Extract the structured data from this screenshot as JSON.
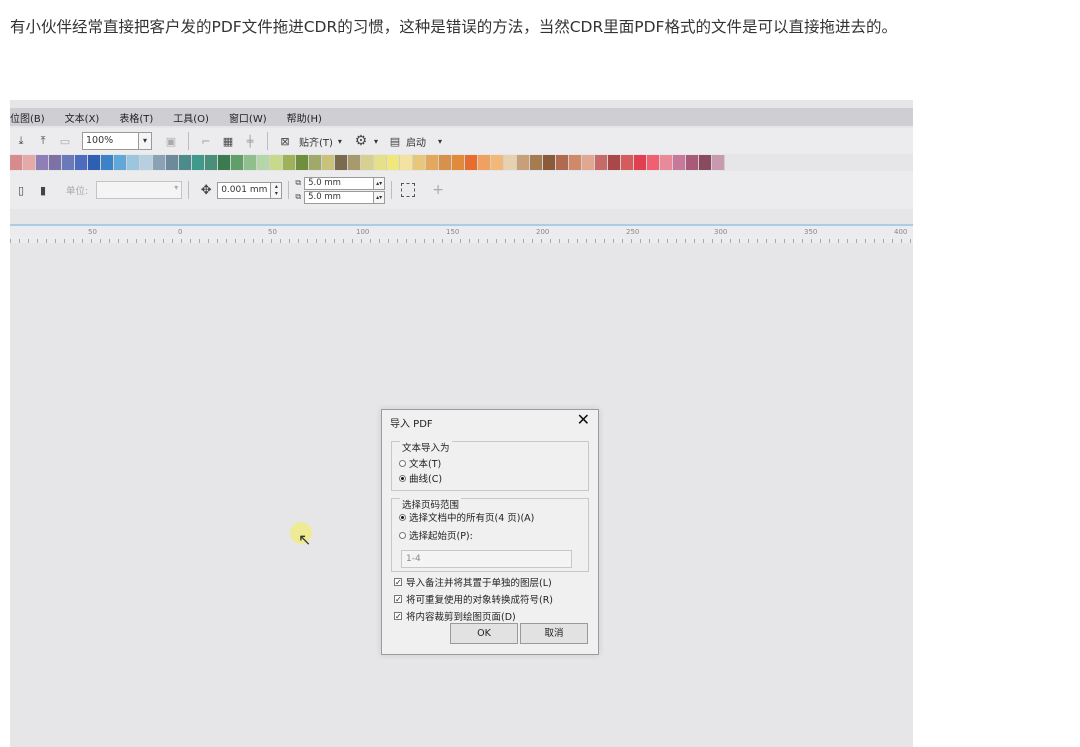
{
  "article": {
    "paragraph": "有小伙伴经常直接把客户发的PDF文件拖进CDR的习惯，这种是错误的方法，当然CDR里面PDF格式的文件是可以直接拖进去的。"
  },
  "app": {
    "menu": [
      "位图(B)",
      "文本(X)",
      "表格(T)",
      "工具(O)",
      "窗口(W)",
      "帮助(H)"
    ],
    "toolbar": {
      "zoom": "100%",
      "snap_label": "贴齐(T)",
      "launch_label": "启动"
    },
    "palette_colors": [
      "#d98b8b",
      "#e7a8a8",
      "#8f7fb6",
      "#7c72a8",
      "#6a79b8",
      "#4c6cc0",
      "#2f5fb3",
      "#3b82c8",
      "#60a8d8",
      "#9cc6e0",
      "#b7cfdf",
      "#8aa2b5",
      "#6d8a9c",
      "#4b8b8c",
      "#3f9a8c",
      "#4a8f7a",
      "#3c7a52",
      "#5fa06a",
      "#8fbf8c",
      "#b5d6a8",
      "#c7d98a",
      "#9fb25a",
      "#6e8f3c",
      "#a0a86a",
      "#c8c27a",
      "#7a6b4e",
      "#a89a6e",
      "#d8d090",
      "#e6e08a",
      "#f0e87a",
      "#f3e2a0",
      "#e9c77a",
      "#e2a95e",
      "#d99048",
      "#e08a3c",
      "#e86d2c",
      "#f0a060",
      "#f3b878",
      "#e6d2b0",
      "#c7a078",
      "#a57b50",
      "#8a5a3a",
      "#b06a50",
      "#d08a6a",
      "#e0a890",
      "#c86a6a",
      "#a84848",
      "#d65c5c",
      "#e04050",
      "#f06070",
      "#e88a9a",
      "#c8789a",
      "#a85a78",
      "#8a4a60",
      "#c89ab0"
    ],
    "propbar": {
      "unit_label": "单位:",
      "nudge": "0.001 mm",
      "dup_x": "5.0 mm",
      "dup_y": "5.0 mm"
    },
    "ruler_labels": [
      "50",
      "0",
      "50",
      "100",
      "150",
      "200",
      "250",
      "300",
      "350",
      "400"
    ]
  },
  "dialog": {
    "title": "导入 PDF",
    "text_group_title": "文本导入为",
    "opt_text": "文本(T)",
    "opt_curves": "曲线(C)",
    "range_group_title": "选择页码范围",
    "opt_all_pages": "选择文档中的所有页(4 页)(A)",
    "opt_start_page": "选择起始页(P):",
    "page_range_value": "1-4",
    "chk_notes": "导入备注并将其置于单独的图层(L)",
    "chk_symbols": "将可重复使用的对象转换成符号(R)",
    "chk_crop": "将内容裁剪到绘图页面(D)",
    "ok_label": "OK",
    "cancel_label": "取消",
    "selected_text_import": "曲线(C)",
    "selected_range": "选择文档中的所有页(4 页)(A)"
  }
}
